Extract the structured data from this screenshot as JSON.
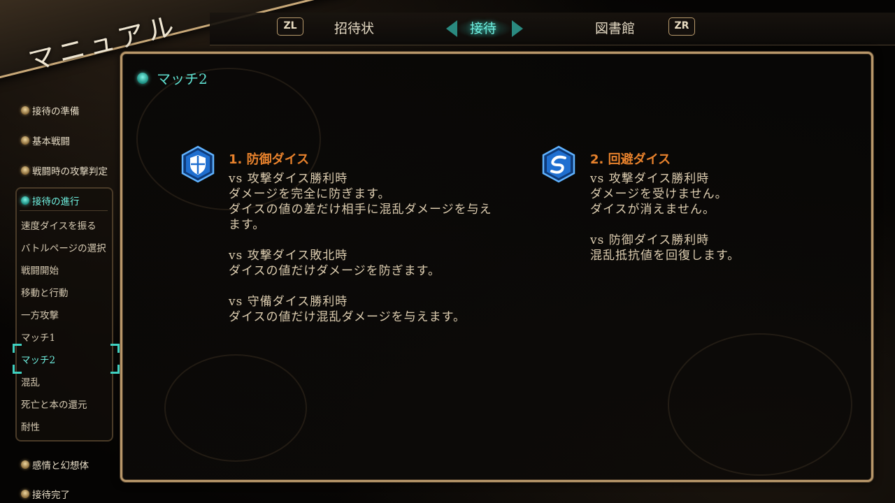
{
  "header": {
    "title": "マニュアル"
  },
  "tabs": {
    "left_button": "ZL",
    "right_button": "ZR",
    "items": [
      {
        "label": "招待状",
        "active": false
      },
      {
        "label": "接待",
        "active": true
      },
      {
        "label": "図書館",
        "active": false
      }
    ]
  },
  "sidebar": {
    "categories_top": [
      {
        "label": "接待の準備"
      },
      {
        "label": "基本戦闘"
      },
      {
        "label": "戦闘時の攻撃判定"
      }
    ],
    "active_category": "接待の進行",
    "subitems": [
      "速度ダイスを振る",
      "バトルページの選択",
      "戦闘開始",
      "移動と行動",
      "一方攻撃",
      "マッチ1",
      "マッチ2",
      "混乱",
      "死亡と本の還元",
      "耐性"
    ],
    "selected_subitem_index": 6,
    "categories_bottom": [
      {
        "label": "感情と幻想体"
      },
      {
        "label": "接待完了"
      }
    ]
  },
  "content": {
    "section_title": "マッチ2",
    "blocks": [
      {
        "icon": "shield-icon",
        "title": "1. 防御ダイス",
        "body": "vs 攻撃ダイス勝利時\nダメージを完全に防ぎます。\nダイスの値の差だけ相手に混乱ダメージを与え\nます。\n\nvs 攻撃ダイス敗北時\nダイスの値だけダメージを防ぎます。\n\nvs 守備ダイス勝利時\nダイスの値だけ混乱ダメージを与えます。"
      },
      {
        "icon": "evade-icon",
        "title": "2. 回避ダイス",
        "body": "vs 攻撃ダイス勝利時\nダメージを受けません。\nダイスが消えません。\n\nvs 防御ダイス勝利時\n混乱抵抗値を回復します。"
      }
    ]
  },
  "colors": {
    "accent_cyan": "#6ff0e0",
    "title_orange": "#e8822c",
    "frame_gold": "#b8976a",
    "dice_blue": "#2a7fd8"
  }
}
